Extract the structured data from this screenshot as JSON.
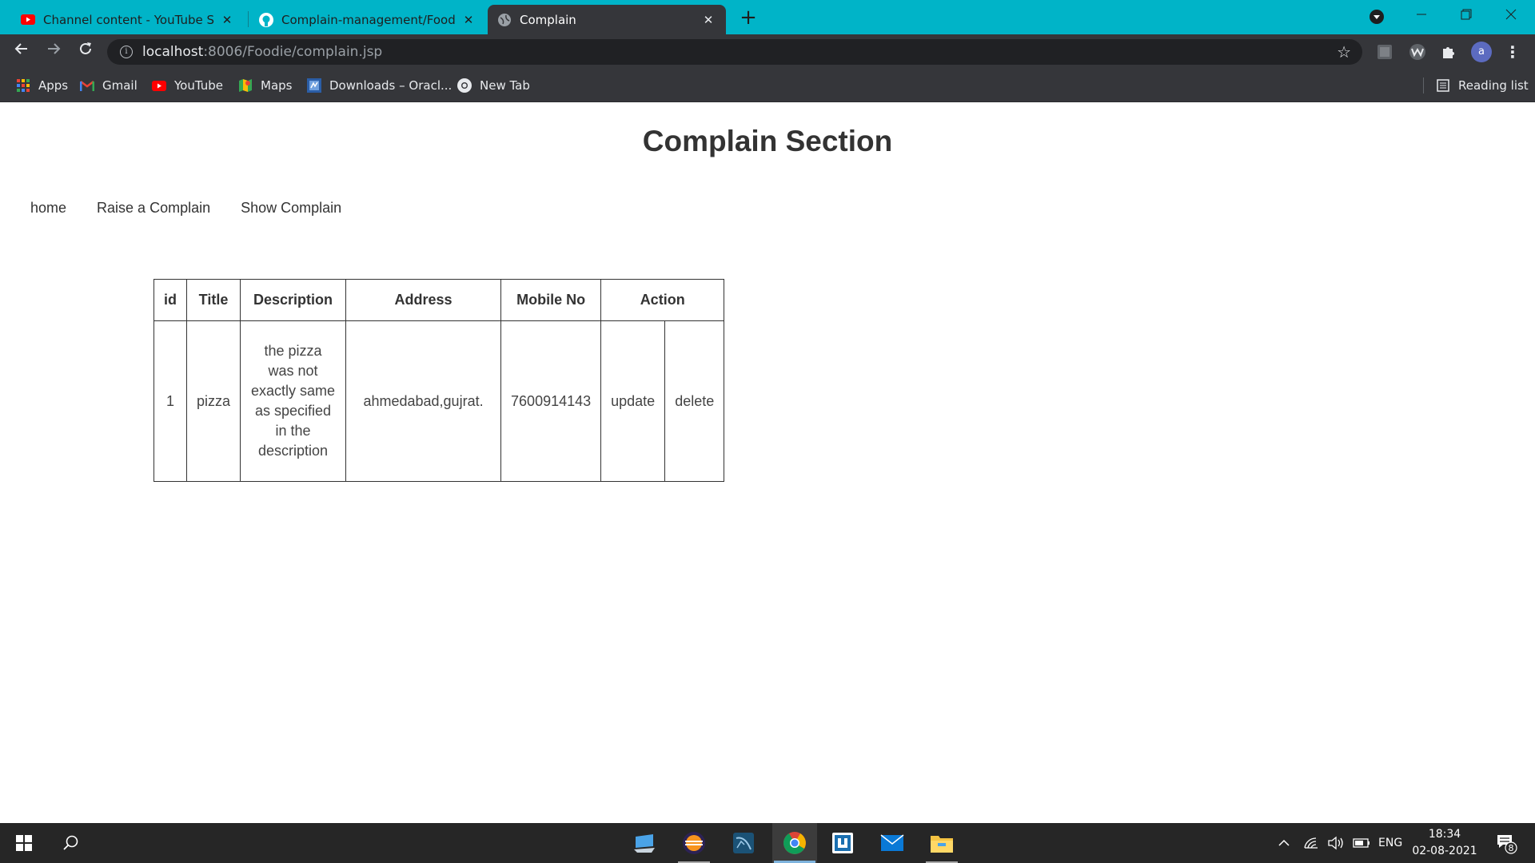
{
  "browser": {
    "tabs": [
      {
        "title": "Channel content - YouTube Studio",
        "icon": "youtube-studio-icon"
      },
      {
        "title": "Complain-management/Foodie at",
        "icon": "github-icon"
      },
      {
        "title": "Complain",
        "icon": "globe-icon",
        "active": true
      }
    ],
    "close_glyph": "✕",
    "new_tab_glyph": "+",
    "url_host": "localhost",
    "url_path": ":8006/Foodie/complain.jsp",
    "profile_initial": "a",
    "bookmarks": [
      {
        "label": "Apps",
        "icon": "apps-grid-icon"
      },
      {
        "label": "Gmail",
        "icon": "gmail-icon"
      },
      {
        "label": "YouTube",
        "icon": "youtube-icon"
      },
      {
        "label": "Maps",
        "icon": "maps-icon"
      },
      {
        "label": "Downloads – Oracl...",
        "icon": "oracle-icon"
      },
      {
        "label": "New Tab",
        "icon": "chrome-icon"
      }
    ],
    "reading_list": "Reading list"
  },
  "page": {
    "title": "Complain Section",
    "nav": [
      "home",
      "Raise a Complain",
      "Show Complain"
    ],
    "table": {
      "headers": [
        "id",
        "Title",
        "Description",
        "Address",
        "Mobile No",
        "Action"
      ],
      "rows": [
        {
          "id": "1",
          "title": "pizza",
          "description": "the pizza was not exactly same as specified in the description",
          "address": "ahmedabad,gujrat.",
          "mobile": "7600914143",
          "update": "update",
          "delete": "delete"
        }
      ]
    }
  },
  "taskbar": {
    "apps": [
      "desktop-icon",
      "eclipse-icon",
      "mysql-workbench-icon",
      "chrome-icon",
      "stack-app-icon",
      "mail-icon",
      "file-explorer-icon"
    ],
    "lang": "ENG",
    "time": "18:34",
    "date": "02-08-2021",
    "notifications": "8"
  },
  "colors": {
    "tabstrip": "#00b4c8",
    "toolbar": "#35363a",
    "omnibox": "#202124",
    "taskbar": "#262626"
  }
}
